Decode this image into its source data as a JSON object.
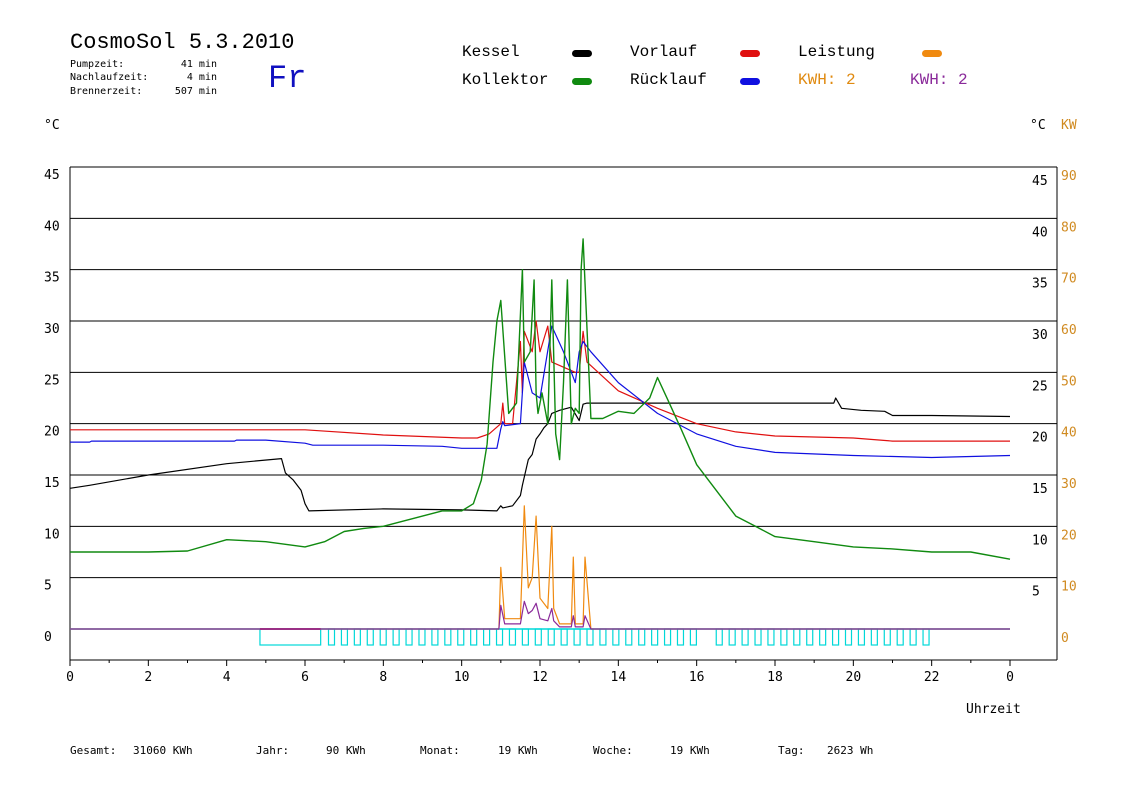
{
  "header": {
    "title": "CosmoSol 5.3.2010",
    "weekday": "Fr",
    "stats": [
      {
        "label": "Pumpzeit:",
        "value": "41 min"
      },
      {
        "label": "Nachlaufzeit:",
        "value": "4 min"
      },
      {
        "label": "Brennerzeit:",
        "value": "507 min"
      }
    ]
  },
  "legend": {
    "kessel": {
      "label": "Kessel",
      "color": "#000000"
    },
    "vorlauf": {
      "label": "Vorlauf",
      "color": "#e01010"
    },
    "leistung": {
      "label": "Leistung",
      "color": "#f08a10"
    },
    "kollektor": {
      "label": "Kollektor",
      "color": "#108a10"
    },
    "ruecklauf": {
      "label": "Rücklauf",
      "color": "#1010e0"
    },
    "kwh_orange": {
      "label": "KWH: 2",
      "color": "#e08a10"
    },
    "kwh_purple": {
      "label": "KWH: 2",
      "color": "#8a2a9a"
    }
  },
  "units": {
    "left": "°C",
    "right_c": "°C",
    "right_kw": "KW"
  },
  "footer": [
    {
      "label": "Gesamt:",
      "value": "31060 KWh"
    },
    {
      "label": "Jahr:",
      "value": "90 KWh"
    },
    {
      "label": "Monat:",
      "value": "19 KWh"
    },
    {
      "label": "Woche:",
      "value": "19 KWh"
    },
    {
      "label": "Tag:",
      "value": "2623 Wh"
    }
  ],
  "chart_data": {
    "type": "line",
    "xlabel": "Uhrzeit",
    "xlim": [
      0,
      24
    ],
    "ylim": [
      0,
      45
    ],
    "y2lim": [
      0,
      90
    ],
    "grid": true,
    "x_ticks": [
      "0",
      "2",
      "4",
      "6",
      "8",
      "10",
      "12",
      "14",
      "16",
      "18",
      "20",
      "22",
      "0"
    ],
    "y_ticks": [
      "0",
      "5",
      "10",
      "15",
      "20",
      "25",
      "30",
      "35",
      "40",
      "45"
    ],
    "y2_ticks": [
      "0",
      "10",
      "20",
      "30",
      "40",
      "50",
      "60",
      "70",
      "80",
      "90"
    ],
    "series": [
      {
        "name": "Kessel",
        "color": "#000000",
        "x": [
          0,
          0.5,
          2,
          4,
          5.4,
          5.5,
          5.7,
          5.9,
          6.0,
          6.1,
          8,
          10,
          10.9,
          11.0,
          11.05,
          11.3,
          11.5,
          11.55,
          11.7,
          11.8,
          11.9,
          12.0,
          12.1,
          12.2,
          12.3,
          12.5,
          12.8,
          13.0,
          13.1,
          13.2,
          14,
          16,
          18,
          19.5,
          19.55,
          19.7,
          20.2,
          20.8,
          21.0,
          22,
          24
        ],
        "y": [
          13.7,
          14.0,
          15.0,
          16.1,
          16.6,
          15.2,
          14.5,
          13.5,
          12.2,
          11.5,
          11.7,
          11.6,
          11.5,
          12.0,
          11.8,
          12.0,
          13.0,
          14.0,
          16.5,
          17.0,
          18.5,
          19.0,
          19.6,
          20.0,
          21.0,
          21.3,
          21.6,
          20.3,
          21.9,
          22.0,
          22.0,
          22.0,
          22.0,
          22.0,
          22.5,
          21.5,
          21.3,
          21.2,
          20.8,
          20.8,
          20.7
        ]
      },
      {
        "name": "Vorlauf",
        "color": "#e01010",
        "x": [
          0,
          4,
          6,
          8,
          10,
          10.4,
          10.7,
          11.0,
          11.05,
          11.1,
          11.3,
          11.5,
          11.55,
          11.6,
          11.8,
          11.9,
          12.0,
          12.2,
          12.3,
          12.6,
          12.9,
          13.0,
          13.1,
          13.2,
          14,
          15,
          16,
          17,
          18,
          19,
          20,
          21,
          22,
          24
        ],
        "y": [
          19.4,
          19.4,
          19.4,
          18.9,
          18.6,
          18.6,
          19.0,
          20.0,
          22.0,
          20.0,
          20.0,
          28.0,
          23.0,
          29.0,
          27.0,
          30.0,
          27.0,
          29.5,
          26.0,
          25.5,
          25.0,
          25.0,
          29.0,
          26.0,
          23.2,
          21.5,
          20.0,
          19.2,
          18.8,
          18.7,
          18.6,
          18.3,
          18.3,
          18.3
        ]
      },
      {
        "name": "Rücklauf",
        "color": "#1010e0",
        "x": [
          0,
          0.5,
          0.55,
          4.2,
          4.25,
          5.0,
          6.0,
          6.2,
          8,
          9.5,
          10.0,
          10.9,
          11.0,
          11.05,
          11.1,
          11.5,
          11.6,
          11.8,
          12.0,
          12.3,
          12.6,
          12.9,
          13.0,
          13.1,
          13.3,
          14,
          15,
          16,
          17,
          18,
          20,
          22,
          24
        ],
        "y": [
          18.2,
          18.2,
          18.3,
          18.3,
          18.4,
          18.4,
          18.1,
          17.9,
          17.9,
          17.8,
          17.6,
          17.6,
          19.5,
          20.2,
          19.8,
          20.0,
          26.0,
          23.0,
          22.5,
          29.5,
          27.0,
          24.0,
          27.0,
          28.0,
          27.0,
          24.0,
          21.0,
          19.0,
          17.8,
          17.2,
          16.9,
          16.7,
          16.9
        ]
      },
      {
        "name": "Kollektor",
        "color": "#108a10",
        "x": [
          0,
          1,
          2,
          3,
          4,
          4.5,
          5,
          6,
          6.5,
          7,
          7.5,
          8,
          8.5,
          9,
          9.5,
          10,
          10.3,
          10.5,
          10.65,
          10.8,
          10.9,
          11.0,
          11.2,
          11.4,
          11.55,
          11.6,
          11.75,
          11.85,
          11.9,
          11.95,
          12.05,
          12.2,
          12.3,
          12.4,
          12.5,
          12.6,
          12.7,
          12.8,
          12.9,
          13.0,
          13.05,
          13.1,
          13.3,
          13.6,
          14.0,
          14.4,
          14.8,
          15.0,
          15.3,
          15.6,
          16.0,
          16.5,
          17.0,
          17.5,
          18.0,
          19.0,
          20.0,
          21.0,
          22.0,
          23.0,
          24.0
        ],
        "y": [
          7.5,
          7.5,
          7.5,
          7.6,
          8.7,
          8.6,
          8.5,
          8.0,
          8.5,
          9.5,
          9.8,
          10.0,
          10.5,
          11.0,
          11.5,
          11.5,
          12.2,
          14.5,
          18.0,
          26.0,
          30.0,
          32.0,
          21.0,
          22.0,
          35.0,
          26.0,
          27.0,
          34.0,
          23.0,
          21.0,
          23.0,
          20.0,
          34.0,
          19.0,
          16.5,
          24.0,
          34.0,
          20.0,
          21.5,
          21.0,
          35.0,
          38.0,
          20.5,
          20.5,
          21.2,
          21.0,
          22.5,
          24.5,
          22.0,
          19.5,
          16.0,
          13.5,
          11.0,
          10.0,
          9.0,
          8.5,
          8.0,
          7.8,
          7.5,
          7.5,
          6.8
        ]
      },
      {
        "name": "Leistung",
        "color": "#f08a10",
        "x": [
          0,
          10.95,
          11.0,
          11.1,
          11.5,
          11.6,
          11.7,
          11.8,
          11.9,
          12.0,
          12.2,
          12.3,
          12.35,
          12.5,
          12.8,
          12.85,
          12.9,
          13.1,
          13.15,
          13.3,
          24
        ],
        "y": [
          0,
          0,
          6,
          1,
          1,
          12,
          4,
          5,
          11,
          3,
          2,
          10,
          2,
          0.5,
          0.5,
          7,
          0.5,
          0.5,
          7,
          0,
          0
        ]
      },
      {
        "name": "Leistung-Tag",
        "color": "#8a2a9a",
        "x": [
          0,
          10.95,
          11.0,
          11.1,
          11.5,
          11.6,
          11.7,
          11.8,
          11.9,
          12.0,
          12.2,
          12.3,
          12.35,
          12.5,
          12.8,
          12.85,
          12.9,
          13.1,
          13.15,
          13.3,
          24
        ],
        "y": [
          0,
          0,
          2.3,
          0.5,
          0.5,
          2.7,
          1.5,
          1.8,
          2.5,
          1.0,
          0.8,
          2.0,
          0.8,
          0.2,
          0.2,
          1.3,
          0.2,
          0.2,
          1.3,
          0,
          0
        ]
      }
    ]
  }
}
